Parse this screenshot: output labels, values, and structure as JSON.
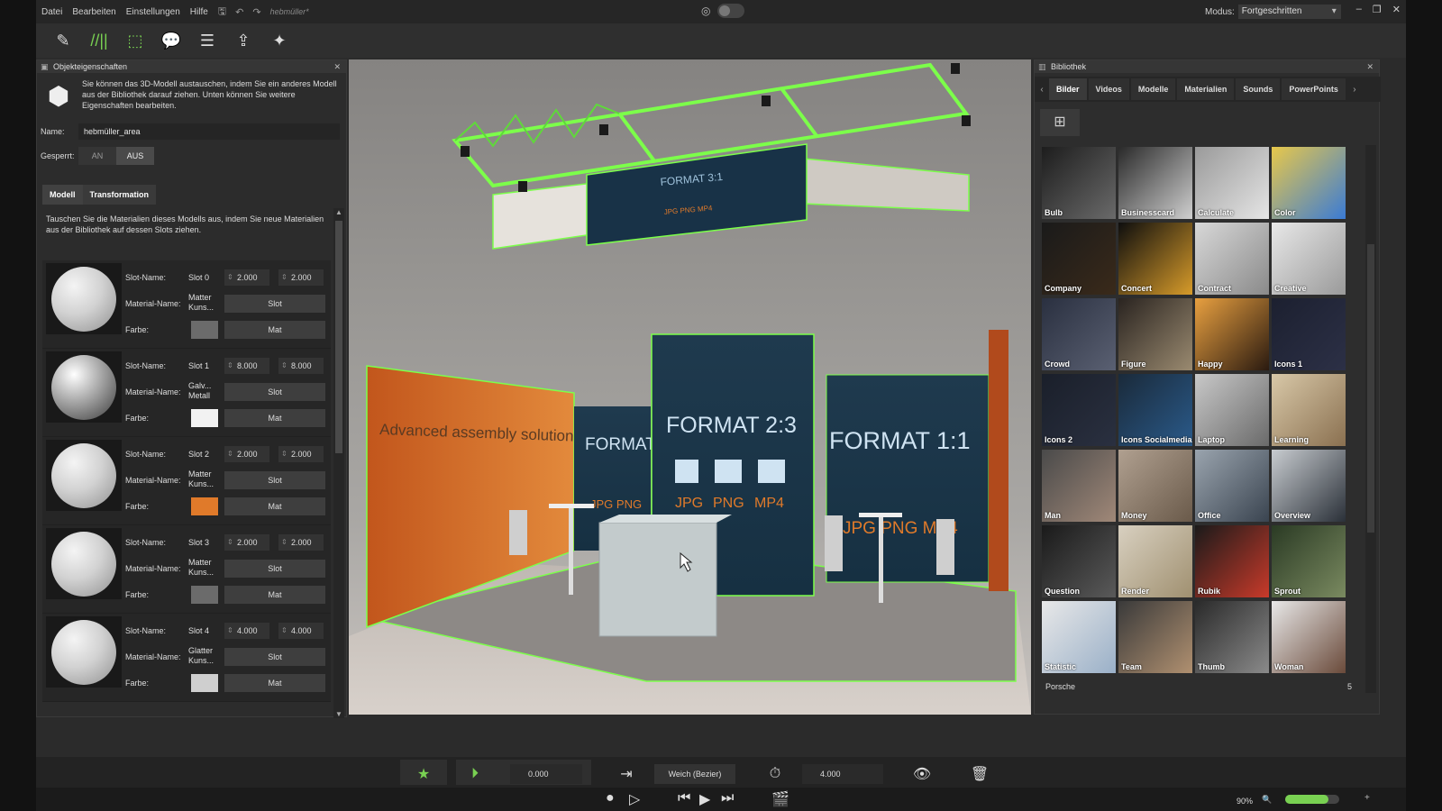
{
  "menu": {
    "items": [
      "Datei",
      "Bearbeiten",
      "Einstellungen",
      "Hilfe"
    ],
    "filename": "hebmüller*"
  },
  "modus": {
    "label": "Modus:",
    "value": "Fortgeschritten"
  },
  "left_panel": {
    "title": "Objekteigenschaften",
    "intro": "Sie können das 3D-Modell austauschen, indem Sie ein anderes Modell aus der Bibliothek darauf ziehen. Unten können Sie weitere Eigenschaften bearbeiten.",
    "name_label": "Name:",
    "name_value": "hebmüller_area",
    "locked_label": "Gesperrt:",
    "locked_on": "AN",
    "locked_off": "AUS",
    "tabs": [
      "Modell",
      "Transformation"
    ],
    "materials_desc": "Tauschen Sie die Materialien dieses Modells aus, indem Sie neue Materialien aus der Bibliothek auf dessen Slots ziehen.",
    "slot_name_label": "Slot-Name:",
    "material_name_label": "Material-Name:",
    "color_label": "Farbe:",
    "slot_button": "Slot",
    "mat_button": "Mat",
    "slots": [
      {
        "slot": "Slot 0",
        "v1": "2.000",
        "v2": "2.000",
        "mat1": "Matter",
        "mat2": "Kuns...",
        "color": "#6b6b6b",
        "metal": false
      },
      {
        "slot": "Slot 1",
        "v1": "8.000",
        "v2": "8.000",
        "mat1": "Galv...",
        "mat2": "Metall",
        "color": "#f2f2f2",
        "metal": true
      },
      {
        "slot": "Slot 2",
        "v1": "2.000",
        "v2": "2.000",
        "mat1": "Matter",
        "mat2": "Kuns...",
        "color": "#e07a2a",
        "metal": false
      },
      {
        "slot": "Slot 3",
        "v1": "2.000",
        "v2": "2.000",
        "mat1": "Matter",
        "mat2": "Kuns...",
        "color": "#6b6b6b",
        "metal": false
      },
      {
        "slot": "Slot 4",
        "v1": "4.000",
        "v2": "4.000",
        "mat1": "Glatter",
        "mat2": "Kuns...",
        "color": "#cfcfcf",
        "metal": false
      }
    ]
  },
  "viewport": {
    "banner_top": "FORMAT 3:1",
    "banner_top_formats": "JPG PNG MP4",
    "wall_left": "Advanced assembly solutions",
    "panel_small": "FORMAT",
    "panel_small_formats": "JPG PNG",
    "panel_center": "FORMAT 2:3",
    "panel_center_formats": [
      "JPG",
      "PNG",
      "MP4"
    ],
    "panel_right": "FORMAT 1:1",
    "panel_right_formats": "JPG PNG MP4"
  },
  "library": {
    "title": "Bibliothek",
    "tabs": [
      "Bilder",
      "Videos",
      "Modelle",
      "Materialien",
      "Sounds",
      "PowerPoints"
    ],
    "items": [
      {
        "name": "Bulb",
        "c1": "#1d1d1d",
        "c2": "#6a6a6a"
      },
      {
        "name": "Businesscard",
        "c1": "#2a2a2a",
        "c2": "#cfcfcf"
      },
      {
        "name": "Calculate",
        "c1": "#9a9a9a",
        "c2": "#e5e5e5"
      },
      {
        "name": "Color",
        "c1": "#e8c84a",
        "c2": "#3a7bd5"
      },
      {
        "name": "Company",
        "c1": "#1a1a1a",
        "c2": "#3a2a1a"
      },
      {
        "name": "Concert",
        "c1": "#0e0e0e",
        "c2": "#d79b2a"
      },
      {
        "name": "Contract",
        "c1": "#d8d8d8",
        "c2": "#8a8a8a"
      },
      {
        "name": "Creative",
        "c1": "#e8e8e8",
        "c2": "#9a9a9a"
      },
      {
        "name": "Crowd",
        "c1": "#2a3040",
        "c2": "#5a6072"
      },
      {
        "name": "Figure",
        "c1": "#2a2420",
        "c2": "#9a8a70"
      },
      {
        "name": "Happy",
        "c1": "#e8a040",
        "c2": "#2a1a10"
      },
      {
        "name": "Icons 1",
        "c1": "#1c2030",
        "c2": "#2c3046"
      },
      {
        "name": "Icons 2",
        "c1": "#1a1f2a",
        "c2": "#2a3040"
      },
      {
        "name": "Icons Socialmedia",
        "c1": "#1a2a3a",
        "c2": "#2a5a8a"
      },
      {
        "name": "Laptop",
        "c1": "#c8c8c8",
        "c2": "#6a6a6a"
      },
      {
        "name": "Learning",
        "c1": "#d8c8a8",
        "c2": "#8a7050"
      },
      {
        "name": "Man",
        "c1": "#4a4a4a",
        "c2": "#a08878"
      },
      {
        "name": "Money",
        "c1": "#b0a090",
        "c2": "#6a5a4a"
      },
      {
        "name": "Office",
        "c1": "#9aa4ae",
        "c2": "#3a4450"
      },
      {
        "name": "Overview",
        "c1": "#c8ccd0",
        "c2": "#2a3038"
      },
      {
        "name": "Question",
        "c1": "#1a1a1a",
        "c2": "#5a5a5a"
      },
      {
        "name": "Render",
        "c1": "#d8d0c0",
        "c2": "#a09070"
      },
      {
        "name": "Rubik",
        "c1": "#1a1a1a",
        "c2": "#c83a2a"
      },
      {
        "name": "Sprout",
        "c1": "#2a3a24",
        "c2": "#7a8a60"
      },
      {
        "name": "Statistic",
        "c1": "#e8e8e8",
        "c2": "#9ab0c8"
      },
      {
        "name": "Team",
        "c1": "#3a3a3a",
        "c2": "#b09070"
      },
      {
        "name": "Thumb",
        "c1": "#2a2a2a",
        "c2": "#8a8a8a"
      },
      {
        "name": "Woman",
        "c1": "#e8e8e8",
        "c2": "#6a4a3a"
      }
    ],
    "footer_name": "Porsche",
    "footer_count": "5"
  },
  "timeline": {
    "start_value": "0.000",
    "easing": "Weich (Bezier)",
    "duration_value": "4.000"
  },
  "status": {
    "zoom": "90%"
  },
  "colors": {
    "accent": "#79d152",
    "highlight": "#7cff4a"
  }
}
